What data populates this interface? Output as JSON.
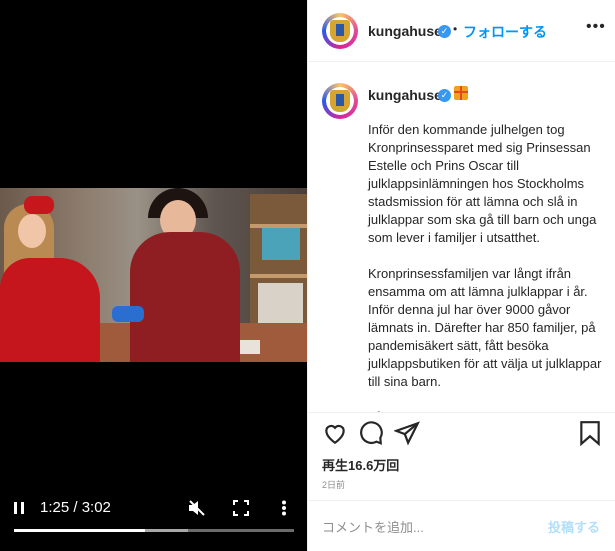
{
  "video": {
    "time_display": "1:25 / 3:02",
    "progress_fraction": 0.467,
    "buffered_fraction": 0.62,
    "controls": {
      "play_pause_icon": "pause-icon",
      "mute_icon": "muted-speaker-icon",
      "fullscreen_icon": "fullscreen-icon",
      "more_icon": "more-vertical-icon"
    }
  },
  "header": {
    "username": "kungahuset",
    "separator": "•",
    "follow_label": "フォローする",
    "more_label": "•••"
  },
  "post": {
    "username": "kungahuset",
    "caption": "Inför den kommande julhelgen tog Kronprinsessparet med sig Prinsessan Estelle och Prins Oscar till julklappsinlämningen hos Stockholms stadsmission för att lämna och slå in julklappar som ska gå till barn och unga som lever i familjer i utsatthet.\n\nKronprinsessfamiljen var långt ifrån ensamma om att lämna julklappar i år. Inför denna jul har över 9000 gåvor lämnats in. Därefter har 850 familjer, på pandemisäkert sätt, fått besöka julklappsbutiken för att välja ut julklappar till sina barn.\n\nI år har Kronprinsessan varit beskyddare av"
  },
  "stats": {
    "views": "再生16.6万回",
    "date": "2日前"
  },
  "comment": {
    "placeholder": "コメントを追加...",
    "post_label": "投稿する"
  },
  "colors": {
    "link_blue": "#0095f6",
    "verified_blue": "#3897f0",
    "post_disabled": "#b2dffc"
  }
}
